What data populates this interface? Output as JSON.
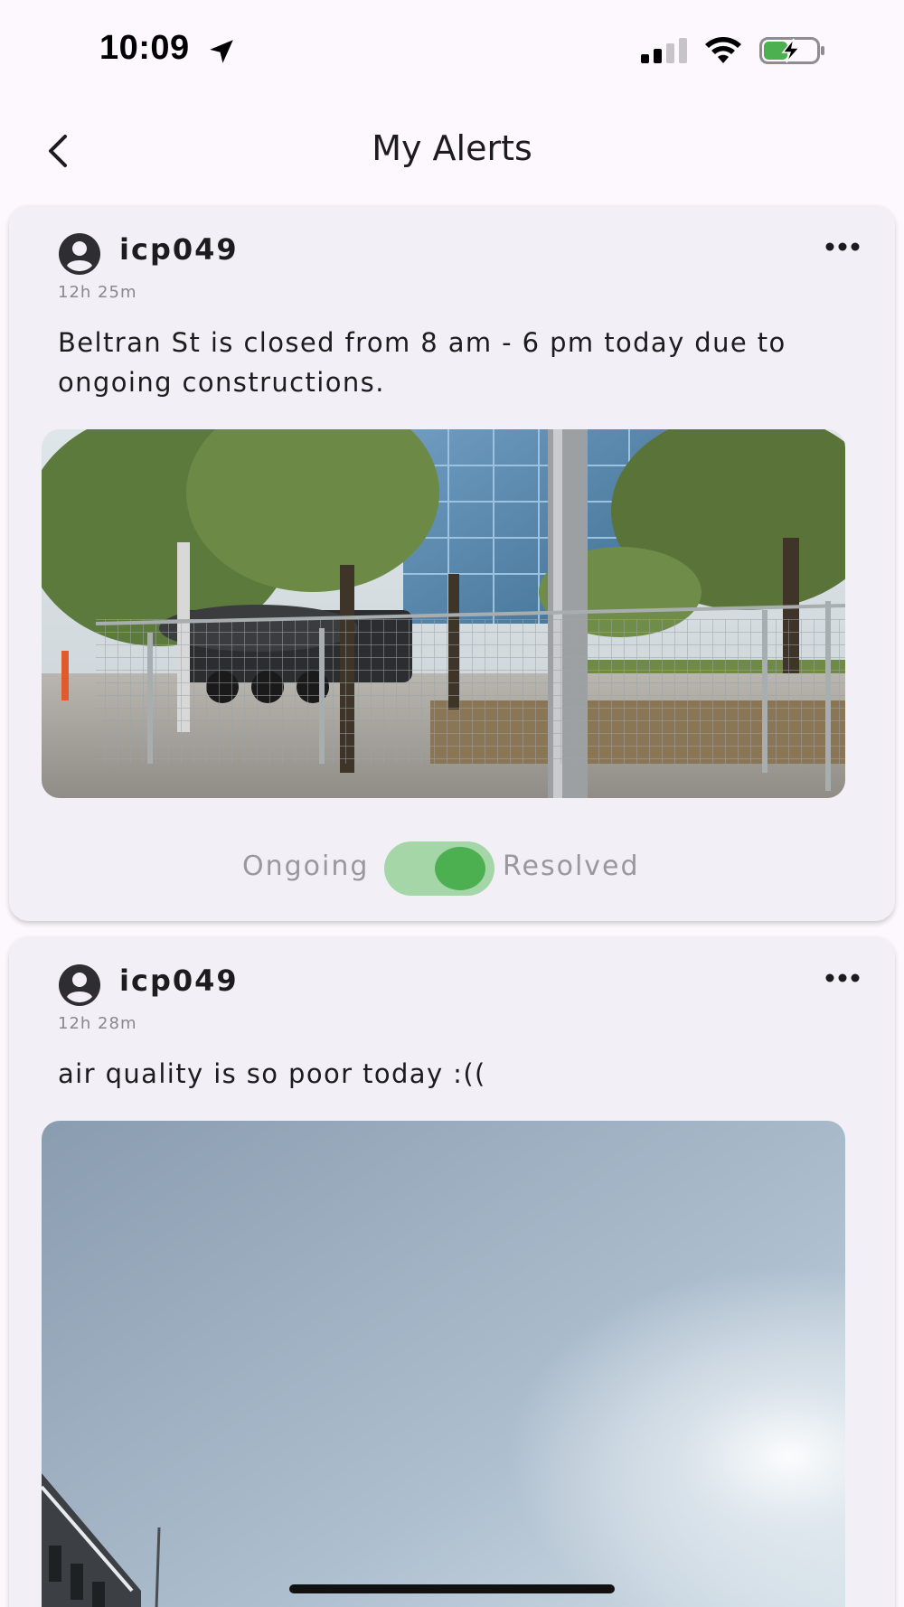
{
  "status_bar": {
    "time": "10:09",
    "icons": [
      "location-arrow-icon",
      "cellular-signal-icon",
      "wifi-icon",
      "battery-charging-icon"
    ],
    "battery_color": "#4caf50"
  },
  "header": {
    "title": "My Alerts",
    "back_icon": "chevron-left-icon"
  },
  "alerts": [
    {
      "username": "icp049",
      "avatar_icon": "account-circle-icon",
      "menu_icon": "more-horizontal-icon",
      "time_ago": "12h 25m",
      "text": "Beltran St is closed from 8 am - 6 pm today due to ongoing constructions.",
      "image": "photo of construction fencing, trees, truck and glass office building",
      "status_toggle": {
        "left_label": "Ongoing",
        "right_label": "Resolved",
        "state": "Resolved"
      }
    },
    {
      "username": "icp049",
      "avatar_icon": "account-circle-icon",
      "menu_icon": "more-horizontal-icon",
      "time_ago": "12h 28m",
      "text": "air quality is so poor today :((",
      "image": "photo of hazy sky above buildings"
    }
  ],
  "colors": {
    "background": "#fcf8fd",
    "card": "#f3eff6",
    "toggle_track": "#a5d6a7",
    "toggle_knob": "#4caf50"
  }
}
